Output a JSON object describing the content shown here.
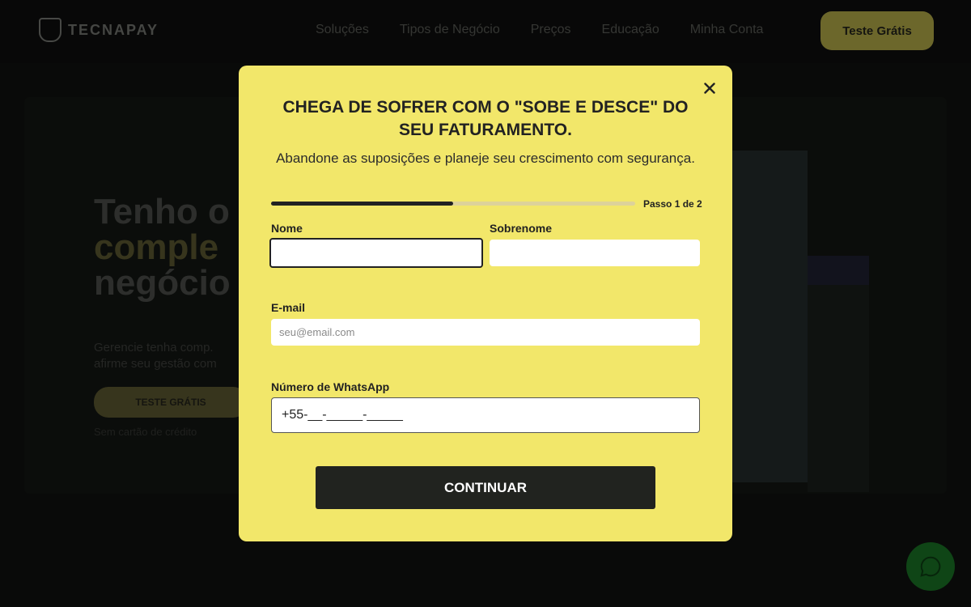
{
  "background": {
    "logo_text": "TECNAPAY",
    "nav": [
      "Soluções",
      "Tipos de Negócio",
      "Preços",
      "Educação",
      "Minha Conta"
    ],
    "nav_cta": "Teste Grátis",
    "hero": {
      "title_line1": "Tenho o",
      "title_line2": "comple",
      "title_line3": "negócio",
      "subtitle": "Gerencie tenha comp. afirme seu gestão com",
      "button": "TESTE GRÁTIS",
      "note": "Sem cartão de crédito"
    }
  },
  "modal": {
    "title": "CHEGA DE SOFRER COM O \"SOBE E DESCE\" DO SEU FATURAMENTO.",
    "subtitle": "Abandone as suposições e planeje seu crescimento com segurança.",
    "progress": 0.5,
    "step_label": "Passo 1 de 2",
    "fields": {
      "first_name_label": "Nome",
      "first_name_value": "",
      "last_name_label": "Sobrenome",
      "last_name_value": "",
      "email_label": "E-mail",
      "email_placeholder": "seu@email.com",
      "whatsapp_label": "Número de WhatsApp",
      "whatsapp_value": "+55-__-_____-_____"
    },
    "continue_label": "CONTINUAR",
    "close_icon": "close-icon"
  },
  "colors": {
    "modal_bg": "#f2e76a",
    "button_bg": "#21231f",
    "fab": "#1e8a2c"
  }
}
